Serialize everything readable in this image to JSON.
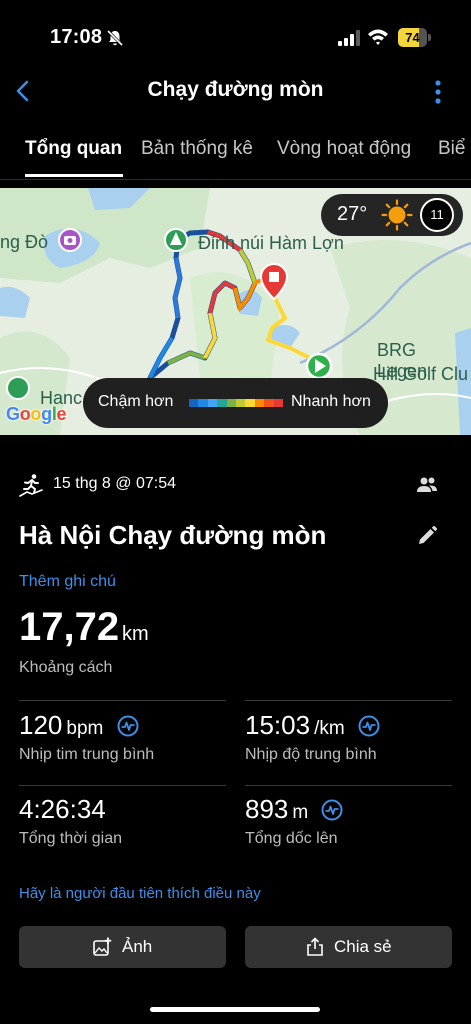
{
  "status": {
    "time": "17:08",
    "battery": "74",
    "battery_fraction": 0.74
  },
  "header": {
    "title": "Chạy đường mòn"
  },
  "tabs": [
    {
      "label": "Tổng quan",
      "active": true
    },
    {
      "label": "Bản thống kê",
      "active": false
    },
    {
      "label": "Vòng hoạt động",
      "active": false
    },
    {
      "label": "Biể",
      "active": false
    }
  ],
  "map": {
    "labels": {
      "place_left": "ng Đò",
      "peak": "Đỉnh núi Hàm Lợn",
      "golf_1": "BRG Legen",
      "golf_2": "Hill Golf Clu",
      "bottom_left": "Hanc"
    },
    "google": "Google",
    "weather": {
      "temp": "27°",
      "moon": "11"
    },
    "legend": {
      "slow": "Chậm hơn",
      "fast": "Nhanh hơn",
      "colors": [
        "#1565c0",
        "#1e88e5",
        "#42a5f5",
        "#26a69a",
        "#7cb342",
        "#c0ca33",
        "#fdd835",
        "#fb8c00",
        "#f4511e",
        "#e53935"
      ]
    }
  },
  "activity": {
    "date": "15 thg 8 @ 07:54",
    "name": "Hà Nội Chạy đường mòn",
    "add_note": "Thêm ghi chú",
    "distance": {
      "value": "17,72",
      "unit": "km",
      "label": "Khoảng cách"
    },
    "stats": {
      "hr": {
        "value": "120",
        "unit": "bpm",
        "label": "Nhịp tim trung bình"
      },
      "pace": {
        "value": "15:03",
        "unit": "/km",
        "label": "Nhịp độ trung bình"
      },
      "time": {
        "value": "4:26:34",
        "label": "Tổng thời gian"
      },
      "ascent": {
        "value": "893",
        "unit": "m",
        "label": "Tổng dốc lên"
      }
    },
    "like_text": "Hãy là người đầu tiên thích điều này",
    "buttons": {
      "photo": "Ảnh",
      "share": "Chia sẻ"
    }
  },
  "colors": {
    "accent": "#3d8fe8",
    "background": "#000000",
    "button": "#333333"
  }
}
